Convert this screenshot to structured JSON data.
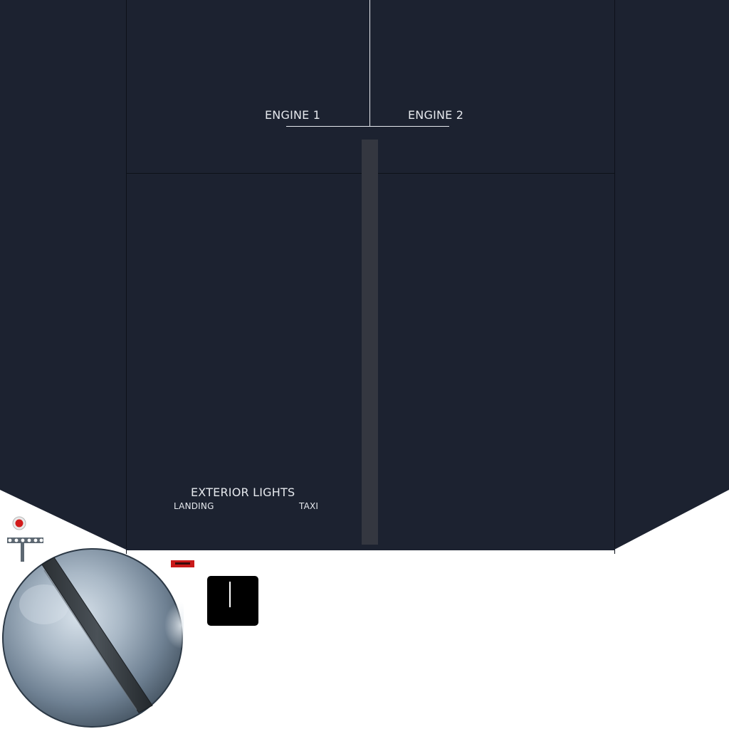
{
  "engines": {
    "engine1_label": "ENGINE 1",
    "engine2_label": "ENGINE 2"
  },
  "exterior_lights": {
    "title": "EXTERIOR LIGHTS",
    "landing_label": "LANDING",
    "taxi_label": "TAXI"
  },
  "colors": {
    "panel": "#1c2230",
    "panel_divider": "#0d1119",
    "label_text": "#e6e9ee",
    "track": "#343740",
    "warning": "#c91a1a",
    "indicator_dot": "#d21b1b"
  },
  "icons": {
    "light_fixture": "indicator-light-icon",
    "knob": "rotary-knob-icon",
    "switch": "toggle-switch-icon"
  }
}
